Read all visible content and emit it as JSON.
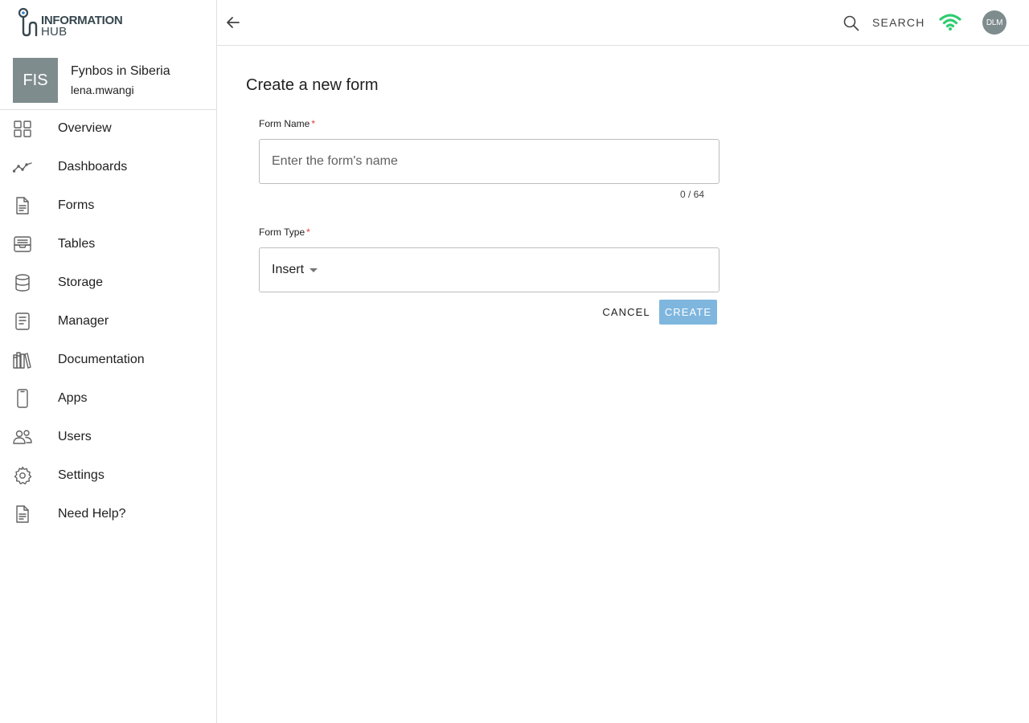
{
  "brand": {
    "line1": "INFORMATION",
    "line2": "HUB"
  },
  "project": {
    "initials": "FIS",
    "name": "Fynbos in Siberia",
    "user": "lena.mwangi"
  },
  "sidebar": {
    "items": [
      {
        "label": "Overview",
        "icon": "grid-icon"
      },
      {
        "label": "Dashboards",
        "icon": "trend-icon"
      },
      {
        "label": "Forms",
        "icon": "document-icon"
      },
      {
        "label": "Tables",
        "icon": "inbox-icon"
      },
      {
        "label": "Storage",
        "icon": "database-icon"
      },
      {
        "label": "Manager",
        "icon": "page-icon"
      },
      {
        "label": "Documentation",
        "icon": "books-icon"
      },
      {
        "label": "Apps",
        "icon": "phone-icon"
      },
      {
        "label": "Users",
        "icon": "users-icon"
      },
      {
        "label": "Settings",
        "icon": "gear-icon"
      },
      {
        "label": "Need Help?",
        "icon": "help-doc-icon"
      }
    ]
  },
  "header": {
    "search_label": "SEARCH",
    "user_initials": "DLM",
    "wifi_color": "#2ecc71"
  },
  "form": {
    "title": "Create a new form",
    "name_label": "Form Name",
    "required_mark": "*",
    "name_placeholder": "Enter the form's name",
    "name_value": "",
    "counter": "0 / 64",
    "type_label": "Form Type",
    "type_value": "Insert",
    "cancel_label": "CANCEL",
    "create_label": "CREATE"
  },
  "colors": {
    "accent_disabled": "#7eb6de",
    "required": "#e53935",
    "avatar_bg": "#7f8c8d"
  }
}
